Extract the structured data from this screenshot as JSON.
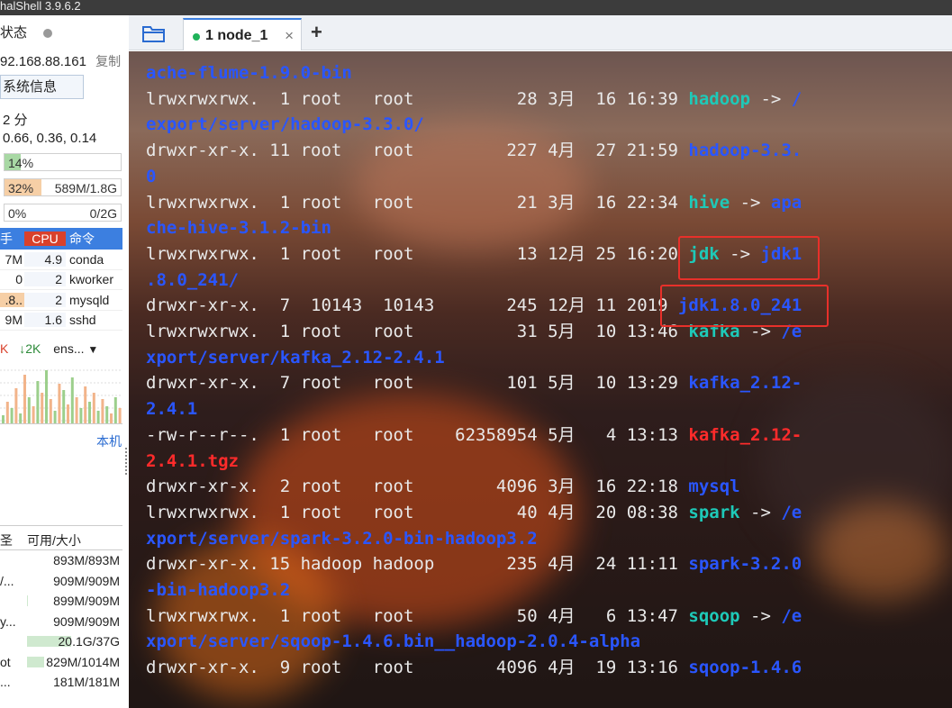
{
  "window": {
    "title": "halShell 3.9.6.2"
  },
  "sidebar": {
    "status_label": "状态",
    "ip": "92.168.88.161",
    "copy": "复制",
    "sysinfo_button": "系统信息",
    "uptime": "2 分",
    "load": "0.66, 0.36, 0.14",
    "cpu": {
      "label": "14%",
      "fraction": 0.14
    },
    "mem": {
      "label": "32%",
      "value": "589M/1.8G",
      "fraction": 0.32
    },
    "swap": {
      "label": "0%",
      "value": "0/2G",
      "fraction": 0.0
    },
    "proc_headers": [
      "手",
      "CPU",
      "命令"
    ],
    "processes": [
      {
        "mem": "7M",
        "cpu": "4.9",
        "cmd": "conda"
      },
      {
        "mem": "0",
        "cpu": "2",
        "cmd": "kworker"
      },
      {
        "mem": ".8..",
        "cpu": "2",
        "cmd": "mysqld"
      },
      {
        "mem": "9M",
        "cpu": "1.6",
        "cmd": "sshd"
      }
    ],
    "net": {
      "up": "K",
      "down": "↓2K",
      "iface": "ens...",
      "dropdown": "▼"
    },
    "local_label": "本机",
    "disk_headers": [
      "圣",
      "可用/大小"
    ],
    "disks": [
      {
        "path": "",
        "usage": "893M/893M",
        "fraction": 0
      },
      {
        "path": "/...",
        "usage": "909M/909M",
        "fraction": 0
      },
      {
        "path": "",
        "usage": "899M/909M",
        "fraction": 0.01
      },
      {
        "path": "y...",
        "usage": "909M/909M",
        "fraction": 0
      },
      {
        "path": "",
        "usage": "20.1G/37G",
        "fraction": 0.46
      },
      {
        "path": "ot",
        "usage": "829M/1014M",
        "fraction": 0.18
      },
      {
        "path": "...",
        "usage": "181M/181M",
        "fraction": 0
      }
    ]
  },
  "tabs": {
    "items": [
      {
        "label": "1 node_1",
        "close": "×"
      }
    ],
    "add": "+"
  },
  "terminal": {
    "lines": [
      [
        {
          "t": "ache-flume-1.9.0-bin",
          "c": "blue"
        }
      ],
      [
        {
          "t": "lrwxrwxrwx.  1 root   root          28 3月  16 16:39 ",
          "c": "n"
        },
        {
          "t": "hadoop",
          "c": "cyan"
        },
        {
          "t": " -> ",
          "c": "n"
        },
        {
          "t": "/",
          "c": "blue"
        }
      ],
      [
        {
          "t": "export/server/hadoop-3.3.0/",
          "c": "blue"
        }
      ],
      [
        {
          "t": "drwxr-xr-x. 11 root   root         227 4月  27 21:59 ",
          "c": "n"
        },
        {
          "t": "hadoop-3.3.",
          "c": "blue"
        }
      ],
      [
        {
          "t": "0",
          "c": "blue"
        }
      ],
      [
        {
          "t": "lrwxrwxrwx.  1 root   root          21 3月  16 22:34 ",
          "c": "n"
        },
        {
          "t": "hive",
          "c": "cyan"
        },
        {
          "t": " -> ",
          "c": "n"
        },
        {
          "t": "apa",
          "c": "blue"
        }
      ],
      [
        {
          "t": "che-hive-3.1.2-bin",
          "c": "blue"
        }
      ],
      [
        {
          "t": "lrwxrwxrwx.  1 root   root          13 12月 25 16:20 ",
          "c": "n"
        },
        {
          "t": "jdk",
          "c": "cyan"
        },
        {
          "t": " -> ",
          "c": "n"
        },
        {
          "t": "jdk1",
          "c": "blue"
        }
      ],
      [
        {
          "t": ".8.0_241/",
          "c": "blue"
        }
      ],
      [
        {
          "t": "drwxr-xr-x.  7  10143  10143       245 12月 11 2019 ",
          "c": "n"
        },
        {
          "t": "jdk1.8.0_241",
          "c": "blue"
        }
      ],
      [
        {
          "t": "lrwxrwxrwx.  1 root   root          31 5月  10 13:46 ",
          "c": "n"
        },
        {
          "t": "kafka",
          "c": "cyan"
        },
        {
          "t": " -> ",
          "c": "n"
        },
        {
          "t": "/e",
          "c": "blue"
        }
      ],
      [
        {
          "t": "xport/server/kafka_2.12-2.4.1",
          "c": "blue"
        }
      ],
      [
        {
          "t": "drwxr-xr-x.  7 root   root         101 5月  10 13:29 ",
          "c": "n"
        },
        {
          "t": "kafka_2.12-",
          "c": "blue"
        }
      ],
      [
        {
          "t": "2.4.1",
          "c": "blue"
        }
      ],
      [
        {
          "t": "-rw-r--r--.  1 root   root    62358954 5月   4 13:13 ",
          "c": "n"
        },
        {
          "t": "kafka_2.12-",
          "c": "red"
        }
      ],
      [
        {
          "t": "2.4.1.tgz",
          "c": "red"
        }
      ],
      [
        {
          "t": "drwxr-xr-x.  2 root   root        4096 3月  16 22:18 ",
          "c": "n"
        },
        {
          "t": "mysql",
          "c": "blue"
        }
      ],
      [
        {
          "t": "lrwxrwxrwx.  1 root   root          40 4月  20 08:38 ",
          "c": "n"
        },
        {
          "t": "spark",
          "c": "cyan"
        },
        {
          "t": " -> ",
          "c": "n"
        },
        {
          "t": "/e",
          "c": "blue"
        }
      ],
      [
        {
          "t": "xport/server/spark-3.2.0-bin-hadoop3.2",
          "c": "blue"
        }
      ],
      [
        {
          "t": "drwxr-xr-x. 15 hadoop hadoop       235 4月  24 11:11 ",
          "c": "n"
        },
        {
          "t": "spark-3.2.0",
          "c": "blue"
        }
      ],
      [
        {
          "t": "-bin-hadoop3.2",
          "c": "blue"
        }
      ],
      [
        {
          "t": "lrwxrwxrwx.  1 root   root          50 4月   6 13:47 ",
          "c": "n"
        },
        {
          "t": "sqoop",
          "c": "cyan"
        },
        {
          "t": " -> ",
          "c": "n"
        },
        {
          "t": "/e",
          "c": "blue"
        }
      ],
      [
        {
          "t": "xport/server/sqoop-1.4.6.bin__hadoop-2.0.4-alpha",
          "c": "blue"
        }
      ],
      [
        {
          "t": "drwxr-xr-x.  9 root   root        4096 4月  19 13:16 ",
          "c": "n"
        },
        {
          "t": "sqoop-1.4.6",
          "c": "blue"
        }
      ]
    ]
  },
  "colors": {
    "accent": "#3c7fe0",
    "highlight": "#e8302a",
    "blue": "#2a56ff",
    "cyan": "#1ec9b8",
    "red": "#ff2b2b"
  }
}
